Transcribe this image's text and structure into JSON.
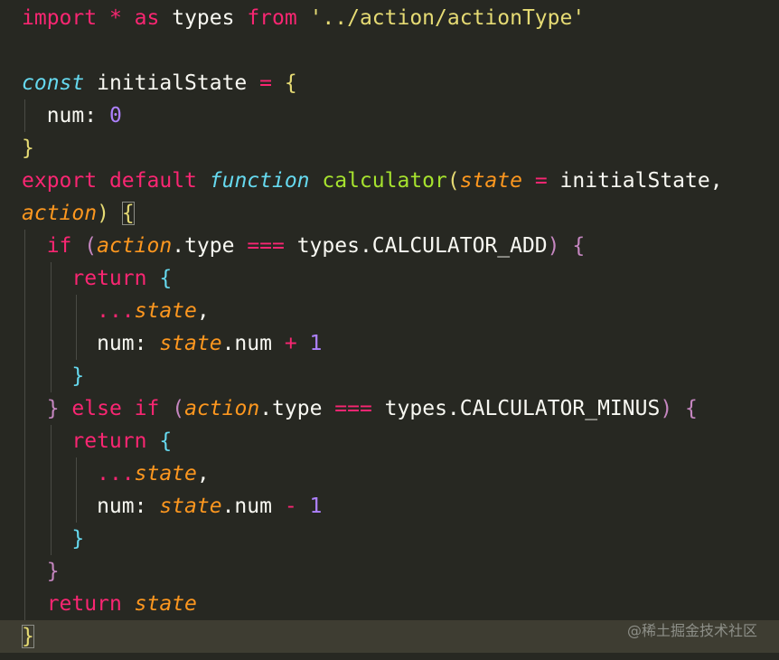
{
  "editor": {
    "watermark": "@稀土掘金技术社区",
    "colors": {
      "background": "#272822",
      "current_line": "#3e3d32",
      "keyword": "#f92672",
      "storage": "#66d9ef",
      "function": "#a6e22e",
      "string": "#e6db74",
      "number": "#ae81ff",
      "parameter": "#fd971f",
      "text": "#f8f8f2"
    },
    "lines": [
      {
        "tokens": [
          "import",
          " ",
          "*",
          " ",
          "as",
          " types ",
          "from",
          " ",
          "'../action/actionType'"
        ]
      },
      {
        "tokens": []
      },
      {
        "tokens": [
          "const",
          " initialState ",
          "=",
          " ",
          "{"
        ]
      },
      {
        "tokens": [
          "  num: ",
          "0"
        ]
      },
      {
        "tokens": [
          "}"
        ]
      },
      {
        "tokens": [
          "export",
          " ",
          "default",
          " ",
          "function",
          " ",
          "calculator",
          "(",
          "state",
          " ",
          "=",
          " initialState,"
        ]
      },
      {
        "tokens": [
          "action",
          ")",
          " ",
          "{"
        ]
      },
      {
        "tokens": [
          "  ",
          "if",
          " ",
          "(",
          "action",
          ".type ",
          "===",
          " types.CALCULATOR_ADD",
          ")",
          " ",
          "{"
        ]
      },
      {
        "tokens": [
          "    ",
          "return",
          " ",
          "{"
        ]
      },
      {
        "tokens": [
          "      ",
          "...",
          "state",
          ","
        ]
      },
      {
        "tokens": [
          "      num: ",
          "state",
          ".num ",
          "+",
          " ",
          "1"
        ]
      },
      {
        "tokens": [
          "    ",
          "}"
        ]
      },
      {
        "tokens": [
          "  ",
          "}",
          " ",
          "else",
          " ",
          "if",
          " ",
          "(",
          "action",
          ".type ",
          "===",
          " types.CALCULATOR_MINUS",
          ")",
          " ",
          "{"
        ]
      },
      {
        "tokens": [
          "    ",
          "return",
          " ",
          "{"
        ]
      },
      {
        "tokens": [
          "      ",
          "...",
          "state",
          ","
        ]
      },
      {
        "tokens": [
          "      num: ",
          "state",
          ".num ",
          "-",
          " ",
          "1"
        ]
      },
      {
        "tokens": [
          "    ",
          "}"
        ]
      },
      {
        "tokens": [
          "  ",
          "}"
        ]
      },
      {
        "tokens": [
          "  ",
          "return",
          " ",
          "state"
        ]
      },
      {
        "tokens": [
          "}"
        ]
      }
    ]
  }
}
